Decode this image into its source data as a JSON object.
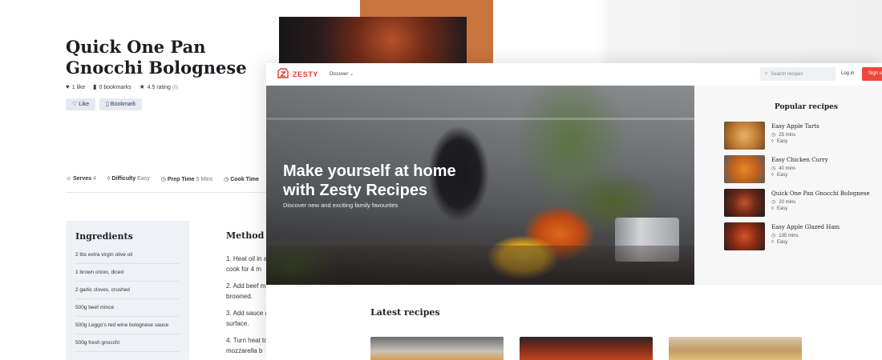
{
  "background_page": {
    "title": "Quick One Pan Gnocchi Bolognese",
    "likes": "1 like",
    "bookmarks": "0 bookmarks",
    "rating": "4.5 rating",
    "rating_count": "(0)",
    "like_button": "Like",
    "bookmark_button": "Bookmark",
    "meta": [
      {
        "label": "Serves",
        "value": "4"
      },
      {
        "label": "Difficulty",
        "value": "Easy"
      },
      {
        "label": "Prep Time",
        "value": "5 Mins"
      },
      {
        "label": "Cook Time",
        "value": ""
      }
    ],
    "ingredients_heading": "Ingredients",
    "ingredients": [
      "2 tbs extra virgin olive oil",
      "1 brown onion, diced",
      "2 garlic cloves, crushed",
      "500g beef mince",
      "500g Leggo's red wine bolognese sauce",
      "500g fresh gnocchi"
    ],
    "method_heading": "Method",
    "method_steps": [
      "1. Heat oil in a",
      "cook for 4 m",
      "2. Add beef m",
      "browned.",
      "3. Add sauce a",
      "surface.",
      "4. Turn heat to",
      "mozzarella b"
    ]
  },
  "zesty": {
    "brand": "ZESTY",
    "nav_discover": "Discover",
    "search_placeholder": "Search recipes",
    "login": "Log in",
    "signup": "Sign up",
    "hero_title": "Make yourself at home with Zesty Recipes",
    "hero_subtitle": "Discover new and exciting family favourites",
    "popular_heading": "Popular recipes",
    "popular": [
      {
        "name": "Easy Apple Tarts",
        "time": "25 mins",
        "difficulty": "Easy",
        "thumb_color": "#c98a3c"
      },
      {
        "name": "Easy Chicken Curry",
        "time": "40 mins",
        "difficulty": "Easy",
        "thumb_color": "#d07a2c"
      },
      {
        "name": "Quick One Pan Gnocchi Bolognese",
        "time": "20 mins",
        "difficulty": "Easy",
        "thumb_color": "#7a2a1e"
      },
      {
        "name": "Easy Apple Glazed Ham",
        "time": "135 mins",
        "difficulty": "Easy",
        "thumb_color": "#a0361c"
      }
    ],
    "latest_heading": "Latest recipes"
  },
  "colors": {
    "brand_red": "#e23b2e",
    "signup_bg": "#ea4a3a",
    "ingredients_bg": "#eef1f5"
  }
}
